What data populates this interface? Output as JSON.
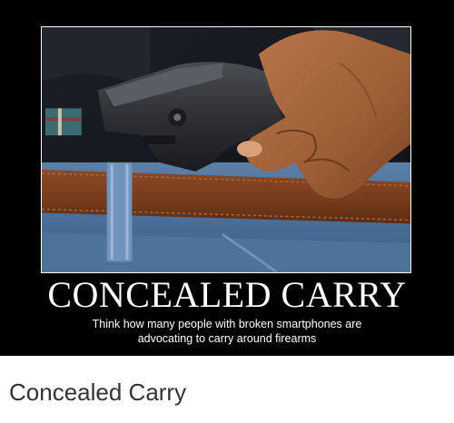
{
  "poster": {
    "title": "CONCEALED CARRY",
    "caption": "Think how many people with broken smartphones are advocating to carry around firearms",
    "colors": {
      "background": "#000000",
      "text": "#ffffff",
      "frame": "#ffffff"
    },
    "photo_icon": "hand-holding-pistol-in-waistband-photo"
  },
  "page": {
    "caption": "Concealed Carry",
    "caption_color": "#333333"
  }
}
